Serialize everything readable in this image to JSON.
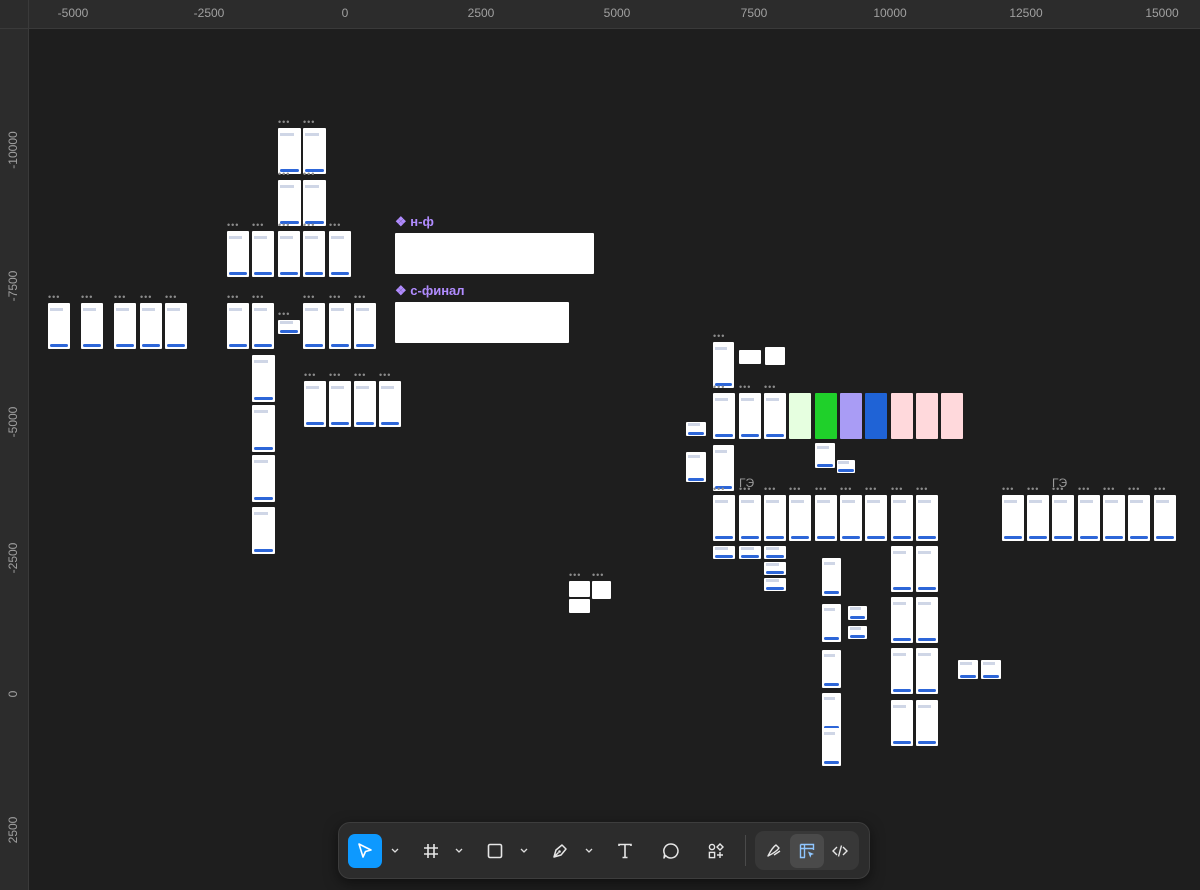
{
  "rulers": {
    "x_labels": [
      "-5000",
      "-2500",
      "0",
      "2500",
      "5000",
      "7500",
      "10000",
      "12500",
      "15000"
    ],
    "y_labels": [
      "-10000",
      "-7500",
      "-5000",
      "-2500",
      "0",
      "2500"
    ]
  },
  "canvas": {
    "sections": [
      {
        "label": "❖ н-ф"
      },
      {
        "label": "❖ с-финал"
      }
    ],
    "group_labels": [
      "ГЭ",
      "ГЭ"
    ],
    "frame_menu_glyph": "•••"
  },
  "toolbar": {
    "tools": [
      {
        "name": "move",
        "icon": "cursor-arrow-icon",
        "active": true
      },
      {
        "name": "frame",
        "icon": "frame-hash-icon"
      },
      {
        "name": "shape",
        "icon": "rectangle-icon"
      },
      {
        "name": "pen",
        "icon": "pen-icon"
      },
      {
        "name": "text",
        "icon": "text-icon"
      },
      {
        "name": "comment",
        "icon": "comment-icon"
      },
      {
        "name": "actions",
        "icon": "actions-icon"
      }
    ],
    "modes": [
      {
        "name": "draw",
        "icon": "draw-icon"
      },
      {
        "name": "design",
        "icon": "design-mode-icon",
        "selected": true
      },
      {
        "name": "dev",
        "icon": "code-icon"
      }
    ],
    "accent": "#0d99ff"
  },
  "colors": {
    "background": "#1e1e1e",
    "ruler": "#2c2c2c",
    "section_label": "#b18cff",
    "frame_button": "#2d66d8"
  }
}
